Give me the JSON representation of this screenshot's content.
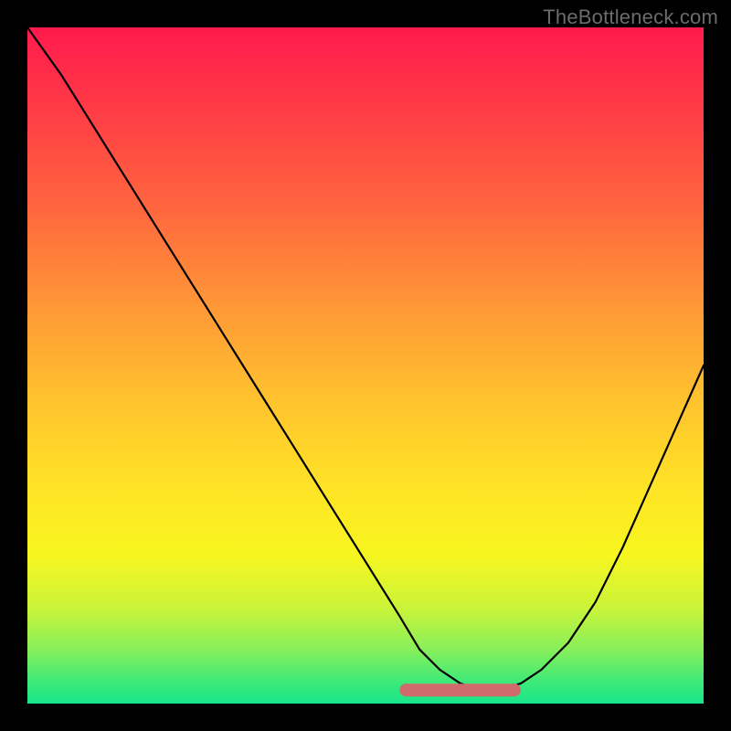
{
  "watermark": "TheBottleneck.com",
  "chart_data": {
    "type": "line",
    "title": "",
    "xlabel": "",
    "ylabel": "",
    "xlim": [
      0,
      100
    ],
    "ylim": [
      0,
      100
    ],
    "grid": false,
    "series": [
      {
        "name": "bottleneck-curve",
        "x": [
          0,
          5,
          10,
          15,
          20,
          25,
          30,
          35,
          40,
          45,
          50,
          55,
          58,
          61,
          64,
          67,
          70,
          73,
          76,
          80,
          84,
          88,
          92,
          96,
          100
        ],
        "values": [
          100,
          93,
          85,
          77,
          69,
          61,
          53,
          45,
          37,
          29,
          21,
          13,
          8,
          5,
          3,
          2,
          2,
          3,
          5,
          9,
          15,
          23,
          32,
          41,
          50
        ]
      }
    ],
    "annotations": [
      {
        "name": "optimal-band",
        "x_range": [
          56,
          72
        ],
        "y": 2,
        "color": "#d16a6a"
      }
    ],
    "legend": false
  }
}
